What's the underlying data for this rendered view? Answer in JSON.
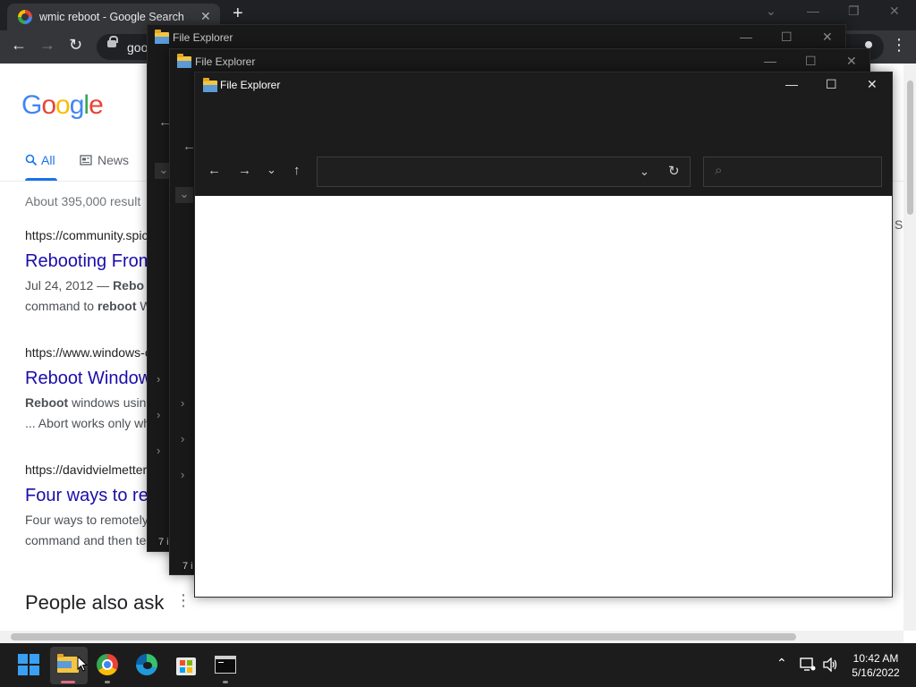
{
  "chrome": {
    "tab_title": "wmic reboot - Google Search",
    "tab_close": "✕",
    "new_tab": "+",
    "omnibox_text": "goo",
    "window_controls": {
      "minimize": "—",
      "restore": "❐",
      "close": "✕",
      "tabs_menu": "⌄"
    },
    "nav": {
      "back": "←",
      "forward": "→",
      "reload": "↻",
      "menu": "⋮"
    }
  },
  "google": {
    "logo": [
      "G",
      "o",
      "o",
      "g",
      "l",
      "e"
    ],
    "logo_colors": [
      "#4285f4",
      "#ea4335",
      "#fbbc05",
      "#4285f4",
      "#34a853",
      "#ea4335"
    ],
    "tabs": [
      {
        "label": "All",
        "icon": "search-icon"
      },
      {
        "label": "News",
        "icon": "news-icon"
      }
    ],
    "stats": "About 395,000 result",
    "results": [
      {
        "cite": "https://community.spic",
        "title": "Rebooting From",
        "snippet1_pre": "Jul 24, 2012 — ",
        "snippet1_bold": "Rebo",
        "snippet2_pre": "command to ",
        "snippet2_bold": "reboot",
        "snippet2_post": " W"
      },
      {
        "cite": "https://www.windows-c",
        "title": "Reboot Window",
        "snippet1_pre": "",
        "snippet1_bold": "Reboot",
        "snippet1_post": " windows using",
        "snippet2_pre": "... Abort works only wh",
        "snippet2_bold": "",
        "snippet2_post": ""
      },
      {
        "cite": "https://davidvielmetter",
        "title": "Four ways to re",
        "snippet1_pre": "Four ways to remotely",
        "snippet1_bold": "",
        "snippet1_post": "",
        "snippet2_pre": "command and then te",
        "snippet2_bold": "",
        "snippet2_post": ""
      }
    ],
    "people_also_ask": "People also ask",
    "right_cut_letter": "S"
  },
  "file_explorer": {
    "windows": [
      {
        "title": "File Explorer",
        "status": "7 i"
      },
      {
        "title": "File Explorer",
        "status": "7 i"
      },
      {
        "title": "File Explorer",
        "status": ""
      }
    ],
    "controls": {
      "minimize": "—",
      "maximize": "☐",
      "close": "✕"
    },
    "nav": {
      "back": "←",
      "forward": "→",
      "recent": "⌄",
      "up": "↑",
      "dropdown": "⌄",
      "refresh": "↻",
      "search": "⌕"
    },
    "chevron": "›"
  },
  "taskbar": {
    "tray_chevron": "⌃",
    "time": "10:42 AM",
    "date": "5/16/2022",
    "accent": "#3aa0f3"
  }
}
